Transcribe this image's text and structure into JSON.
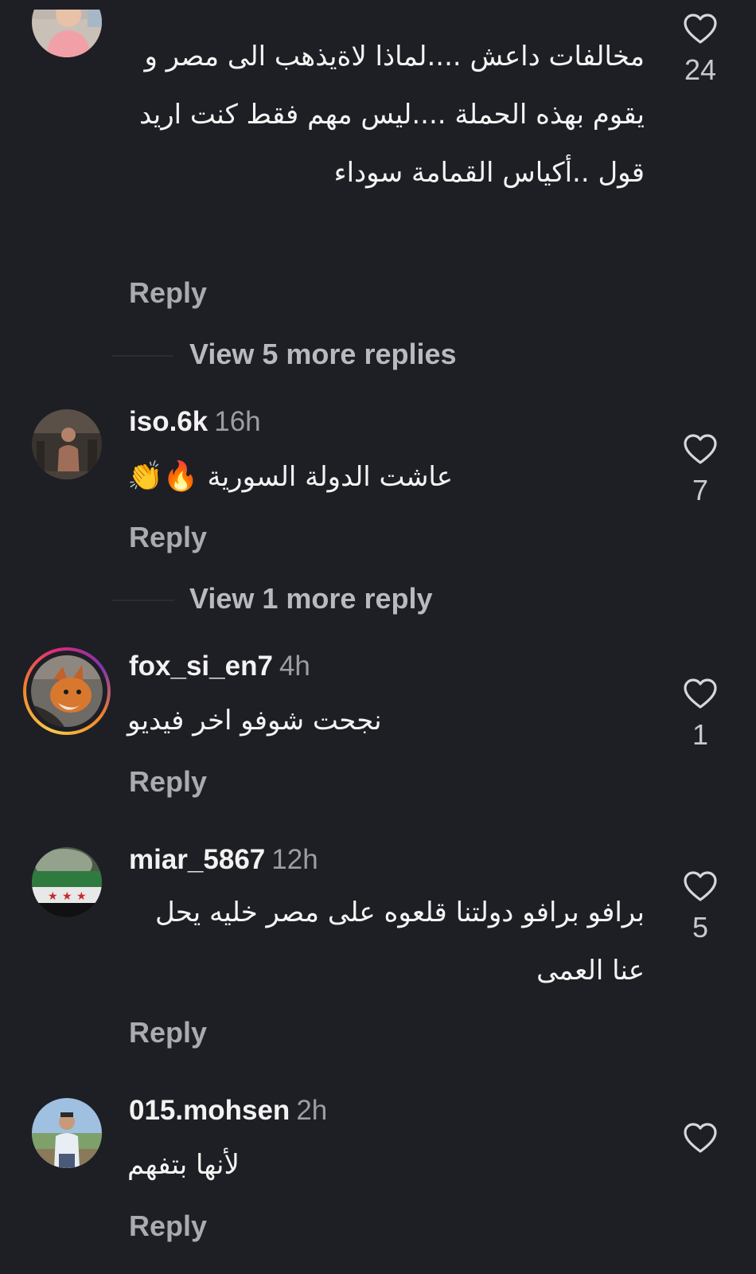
{
  "colors": {
    "background": "#1e1f24",
    "username": "#f2f2f2",
    "secondary_text": "#9c9ea5",
    "reply": "#a9abb1",
    "story_ring": [
      "#f7c94a",
      "#f58529",
      "#dd2a7b",
      "#8134af"
    ]
  },
  "comments": [
    {
      "avatar_icon": "person-pink-shirt-avatar",
      "text": "مخالفات داعش ....لماذا لاةيذهب الى مصر و يقوم بهذه الحملة ....ليس مهم فقط كنت اريد قول ..أكياس القمامة سوداء",
      "reply_label": "Reply",
      "likes": "24"
    },
    {
      "username": "iso.6k",
      "time": "16h",
      "avatar_icon": "gym-person-avatar",
      "text": "عاشت الدولة السورية",
      "emojis": "🔥👏",
      "reply_label": "Reply",
      "likes": "7"
    },
    {
      "username": "fox_si_en7",
      "time": "4h",
      "avatar_icon": "fox-avatar",
      "has_story_ring": true,
      "text": "نجحت شوفو اخر فيديو",
      "reply_label": "Reply",
      "likes": "1"
    },
    {
      "username": "miar_5867",
      "time": "12h",
      "avatar_icon": "syrian-flag-avatar",
      "text": "برافو برافو دولتنا قلعوه على مصر خليه يحل عنا العمى",
      "reply_label": "Reply",
      "likes": "5"
    },
    {
      "username": "015.mohsen",
      "time": "2h",
      "avatar_icon": "man-outdoor-avatar",
      "text": "لأنها بتفهم",
      "reply_label": "Reply",
      "likes": ""
    }
  ],
  "view_more": [
    "View 5 more replies",
    "View 1 more reply"
  ]
}
